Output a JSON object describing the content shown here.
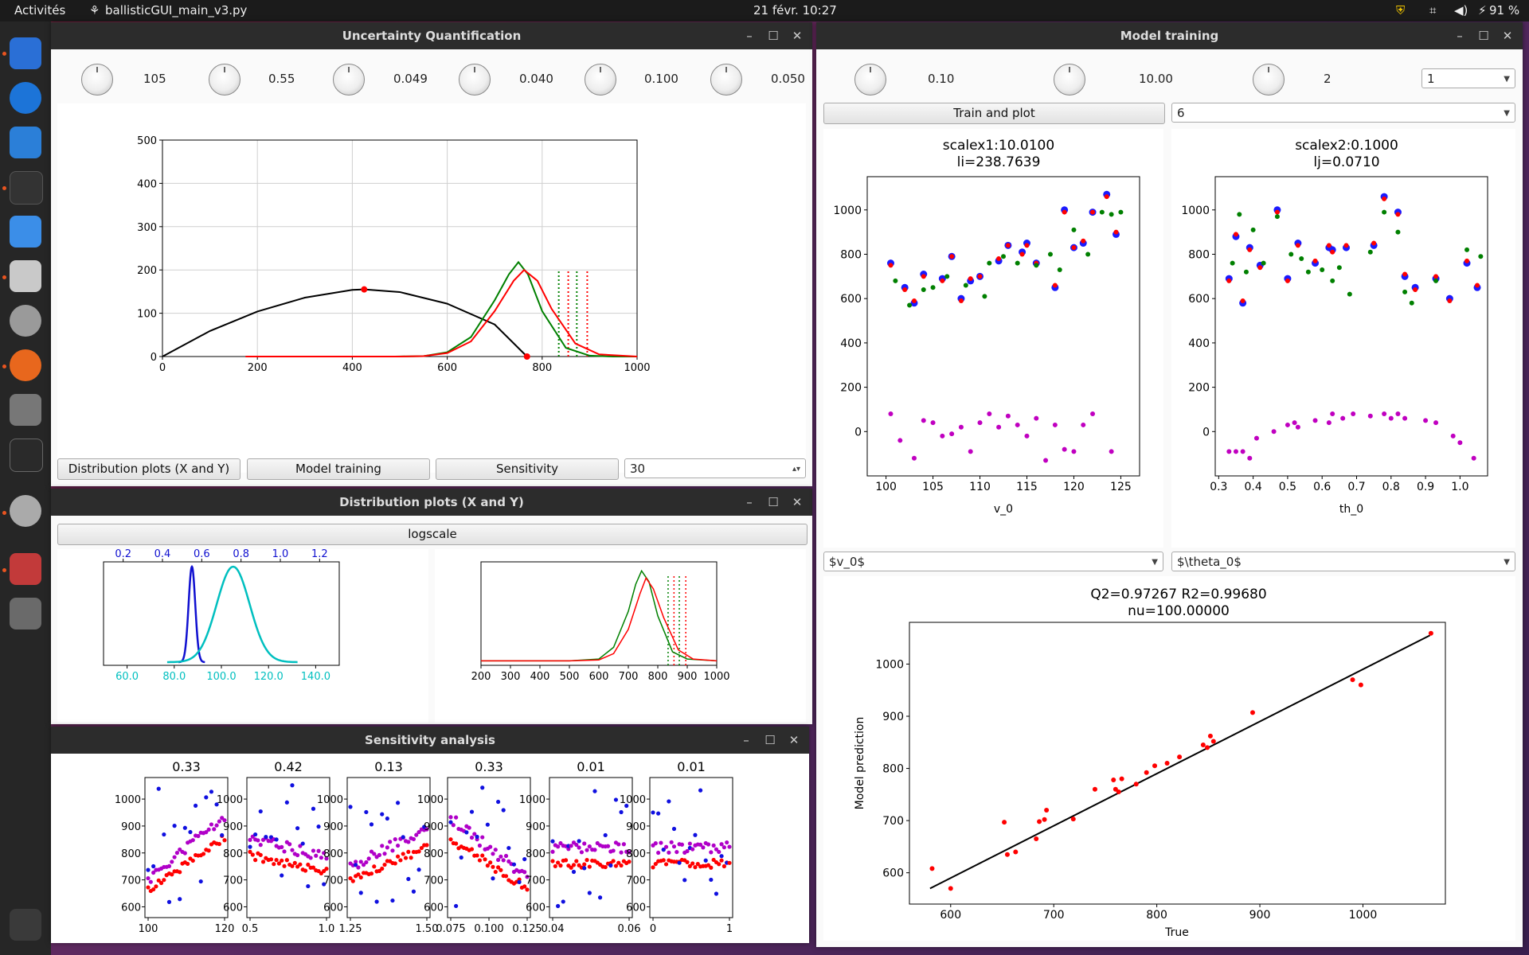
{
  "topbar": {
    "activities": "Activités",
    "app_name": "ballisticGUI_main_v3.py",
    "clock": "21 févr.  10:27",
    "battery": "91 %"
  },
  "uq": {
    "title": "Uncertainty Quantification",
    "knob_values": [
      "105",
      "0.55",
      "0.049",
      "0.040",
      "0.100",
      "0.050"
    ],
    "btn_distribution": "Distribution plots (X and Y)",
    "btn_training": "Model training",
    "btn_sensitivity": "Sensitivity",
    "spin_value": "30"
  },
  "dist": {
    "title": "Distribution plots (X and Y)",
    "logscale": "logscale"
  },
  "sens": {
    "title": "Sensitivity analysis"
  },
  "mt": {
    "title": "Model training",
    "knob_values": [
      "0.10",
      "10.00",
      "2"
    ],
    "combo_top": "1",
    "btn_train": "Train and plot",
    "combo_second": "6",
    "combo_x1": "$v_0$",
    "combo_x2": "$\\theta_0$"
  },
  "chart_data": [
    {
      "id": "trajectory",
      "type": "line",
      "xlim": [
        0,
        1000
      ],
      "ylim": [
        0,
        500
      ],
      "xticks": [
        "0",
        "200",
        "400",
        "600",
        "800",
        "1000"
      ],
      "yticks": [
        "0",
        "100",
        "200",
        "300",
        "400",
        "500"
      ],
      "grid": true,
      "series": [
        {
          "color": "#000000",
          "x": [
            0,
            100,
            200,
            300,
            400,
            425,
            500,
            600,
            700,
            768
          ],
          "y": [
            0,
            59,
            104,
            136,
            154,
            155,
            149,
            122,
            74,
            0
          ]
        },
        {
          "color": "#008000",
          "x": [
            490,
            550,
            600,
            650,
            700,
            730,
            750,
            770,
            800,
            850,
            900,
            950,
            1000
          ],
          "y": [
            0,
            1,
            10,
            45,
            130,
            190,
            218,
            190,
            105,
            20,
            2,
            0,
            0
          ]
        },
        {
          "color": "#ff0000",
          "x": [
            175,
            500,
            550,
            600,
            650,
            700,
            740,
            762,
            790,
            820,
            870,
            920,
            1000
          ],
          "y": [
            0,
            0,
            1,
            8,
            35,
            105,
            175,
            200,
            175,
            110,
            30,
            5,
            0
          ]
        }
      ],
      "points": [
        {
          "x": 425,
          "y": 155,
          "color": "#ff0000"
        },
        {
          "x": 768,
          "y": 0,
          "color": "#ff0000"
        }
      ],
      "vlines": [
        {
          "x": 835,
          "color": "#008000"
        },
        {
          "x": 855,
          "color": "#ff0000"
        },
        {
          "x": 873,
          "color": "#008000"
        },
        {
          "x": 895,
          "color": "#ff0000"
        }
      ]
    },
    {
      "id": "input_dists",
      "type": "line",
      "x_bottom_ticks": [
        "60.0",
        "80.0",
        "100.0",
        "120.0",
        "140.0"
      ],
      "x_top_ticks": [
        "0.2",
        "0.4",
        "0.6",
        "0.8",
        "1.0",
        "1.2"
      ],
      "series": [
        {
          "color": "#1010d0",
          "center": 0.55,
          "sd": 0.017,
          "axis": "top",
          "xlim": [
            0.1,
            1.3
          ]
        },
        {
          "color": "#00bfbf",
          "center": 105,
          "sd": 7,
          "axis": "bottom",
          "xlim": [
            50,
            150
          ]
        }
      ]
    },
    {
      "id": "output_dist",
      "type": "line",
      "xlim": [
        200,
        1000
      ],
      "xticks": [
        "200",
        "300",
        "400",
        "500",
        "600",
        "700",
        "800",
        "900",
        "1000"
      ],
      "series": [
        {
          "color": "#008000",
          "x": [
            200,
            500,
            600,
            650,
            700,
            725,
            745,
            770,
            800,
            850,
            900,
            1000
          ],
          "y": [
            0,
            0,
            2,
            15,
            55,
            85,
            100,
            88,
            50,
            10,
            2,
            0
          ]
        },
        {
          "color": "#ff0000",
          "x": [
            200,
            500,
            600,
            650,
            700,
            740,
            760,
            785,
            820,
            870,
            920,
            1000
          ],
          "y": [
            0,
            0,
            1,
            8,
            35,
            75,
            92,
            80,
            48,
            12,
            2,
            0
          ]
        }
      ],
      "vlines": [
        {
          "x": 835,
          "color": "#008000"
        },
        {
          "x": 855,
          "color": "#ff0000"
        },
        {
          "x": 873,
          "color": "#008000"
        },
        {
          "x": 895,
          "color": "#ff0000"
        }
      ]
    },
    {
      "id": "sensitivity",
      "type": "scatter",
      "panel_titles": [
        "0.33",
        "0.42",
        "0.13",
        "0.33",
        "0.01",
        "0.01"
      ],
      "yticks": [
        "600",
        "700",
        "800",
        "900",
        "1000"
      ],
      "xtick_labels": [
        [
          "100",
          "120"
        ],
        [
          "0.5",
          "1.0"
        ],
        [
          "1.25",
          "1.50"
        ],
        [
          "0.075",
          "0.100",
          "0.125"
        ],
        [
          "0.04",
          "0.06"
        ],
        [
          "0",
          "1"
        ]
      ],
      "series_colors": [
        "#1010e0",
        "#ff0000",
        "#b000c8"
      ]
    },
    {
      "id": "gp_x1",
      "type": "scatter",
      "title": "scalex1:10.0100\nli=238.7639",
      "xlabel": "v_0",
      "xlim": [
        98,
        127
      ],
      "ylim": [
        -200,
        1150
      ],
      "xticks": [
        "100",
        "105",
        "110",
        "115",
        "120",
        "125"
      ],
      "yticks": [
        "0",
        "200",
        "400",
        "600",
        "800",
        "1000"
      ],
      "series": [
        {
          "color": "#1a1aff",
          "x": [
            100.5,
            102,
            103,
            104,
            106,
            107,
            108,
            109,
            110,
            112,
            113,
            114.5,
            115,
            116,
            118,
            119,
            120,
            121,
            122,
            123.5,
            124.5
          ],
          "y": [
            760,
            650,
            580,
            710,
            690,
            790,
            600,
            680,
            700,
            770,
            840,
            810,
            850,
            760,
            650,
            1000,
            830,
            850,
            990,
            1070,
            890
          ]
        },
        {
          "color": "#ff0000",
          "x": [
            100.5,
            102,
            103,
            104,
            106,
            107,
            108,
            109,
            110,
            112,
            113,
            114.5,
            115,
            116,
            118,
            119,
            120,
            121,
            122,
            123.5,
            124.5
          ],
          "y": [
            750,
            640,
            590,
            700,
            680,
            790,
            590,
            690,
            700,
            780,
            840,
            800,
            840,
            760,
            660,
            990,
            830,
            860,
            990,
            1060,
            900
          ]
        },
        {
          "color": "#008000",
          "x": [
            101,
            102.5,
            104,
            105,
            106.5,
            108.5,
            110.5,
            111,
            112.5,
            114,
            116,
            117.5,
            118.5,
            120,
            121.5,
            123,
            124,
            125
          ],
          "y": [
            680,
            570,
            640,
            650,
            700,
            660,
            610,
            760,
            790,
            760,
            750,
            800,
            730,
            910,
            800,
            990,
            980,
            990
          ]
        },
        {
          "color": "#c000c0",
          "x": [
            100.5,
            101.5,
            103,
            104,
            105,
            106,
            107,
            108,
            109,
            110,
            111,
            112,
            113,
            114,
            115,
            116,
            117,
            118,
            119,
            120,
            121,
            122,
            124
          ],
          "y": [
            80,
            -40,
            -120,
            50,
            40,
            -20,
            -10,
            20,
            -90,
            40,
            80,
            20,
            70,
            30,
            -20,
            60,
            -130,
            30,
            -80,
            -90,
            30,
            80,
            -90
          ]
        }
      ]
    },
    {
      "id": "gp_x2",
      "type": "scatter",
      "title": "scalex2:0.1000\nlj=0.0710",
      "xlabel": "th_0",
      "xlim": [
        0.29,
        1.08
      ],
      "ylim": [
        -200,
        1150
      ],
      "xticks": [
        "0.3",
        "0.4",
        "0.5",
        "0.6",
        "0.7",
        "0.8",
        "0.9",
        "1.0"
      ],
      "yticks": [
        "0",
        "200",
        "400",
        "600",
        "800",
        "1000"
      ],
      "series": [
        {
          "color": "#1a1aff",
          "x": [
            0.33,
            0.35,
            0.37,
            0.39,
            0.42,
            0.47,
            0.5,
            0.53,
            0.58,
            0.62,
            0.63,
            0.67,
            0.75,
            0.78,
            0.82,
            0.84,
            0.87,
            0.93,
            0.97,
            1.02,
            1.05
          ],
          "y": [
            690,
            880,
            580,
            830,
            750,
            1000,
            690,
            850,
            760,
            830,
            820,
            830,
            840,
            1060,
            990,
            700,
            650,
            690,
            600,
            760,
            650
          ]
        },
        {
          "color": "#ff0000",
          "x": [
            0.33,
            0.35,
            0.37,
            0.39,
            0.42,
            0.47,
            0.5,
            0.53,
            0.58,
            0.62,
            0.63,
            0.67,
            0.75,
            0.78,
            0.82,
            0.84,
            0.87,
            0.93,
            0.97,
            1.02,
            1.05
          ],
          "y": [
            680,
            890,
            590,
            820,
            740,
            990,
            680,
            840,
            770,
            840,
            810,
            840,
            850,
            1050,
            980,
            710,
            640,
            700,
            590,
            770,
            660
          ]
        },
        {
          "color": "#008000",
          "x": [
            0.34,
            0.36,
            0.38,
            0.4,
            0.43,
            0.47,
            0.51,
            0.54,
            0.56,
            0.6,
            0.63,
            0.65,
            0.68,
            0.74,
            0.78,
            0.82,
            0.84,
            0.86,
            0.93,
            1.02,
            1.06
          ],
          "y": [
            760,
            980,
            720,
            910,
            760,
            970,
            800,
            780,
            720,
            730,
            680,
            740,
            620,
            810,
            990,
            900,
            630,
            580,
            680,
            820,
            790
          ]
        },
        {
          "color": "#c000c0",
          "x": [
            0.33,
            0.35,
            0.37,
            0.39,
            0.41,
            0.46,
            0.5,
            0.52,
            0.53,
            0.58,
            0.62,
            0.63,
            0.66,
            0.69,
            0.74,
            0.78,
            0.8,
            0.82,
            0.84,
            0.9,
            0.93,
            0.98,
            1.0,
            1.04
          ],
          "y": [
            -90,
            -90,
            -90,
            -120,
            -30,
            0,
            30,
            40,
            20,
            50,
            40,
            80,
            60,
            80,
            70,
            80,
            60,
            80,
            60,
            50,
            40,
            -20,
            -50,
            -120
          ]
        }
      ]
    },
    {
      "id": "parity",
      "type": "scatter",
      "title": "Q2=0.97267 R2=0.99680\nnu=100.00000",
      "xlabel": "True",
      "ylabel": "Model prediction",
      "xlim": [
        560,
        1080
      ],
      "ylim": [
        540,
        1080
      ],
      "xticks": [
        "600",
        "700",
        "800",
        "900",
        "1000"
      ],
      "yticks": [
        "600",
        "700",
        "800",
        "900",
        "1000"
      ],
      "line": [
        [
          580,
          570
        ],
        [
          1065,
          1055
        ]
      ],
      "series": [
        {
          "color": "#ff0000",
          "x": [
            582,
            600,
            652,
            655,
            663,
            683,
            686,
            691,
            693,
            719,
            740,
            758,
            760,
            763,
            766,
            780,
            790,
            798,
            810,
            822,
            845,
            849,
            852,
            855,
            893,
            990,
            998,
            1066
          ],
          "y": [
            608,
            570,
            697,
            635,
            640,
            665,
            698,
            702,
            720,
            703,
            760,
            778,
            760,
            755,
            780,
            770,
            792,
            805,
            810,
            822,
            845,
            840,
            862,
            852,
            907,
            970,
            960,
            1059
          ]
        }
      ]
    }
  ]
}
